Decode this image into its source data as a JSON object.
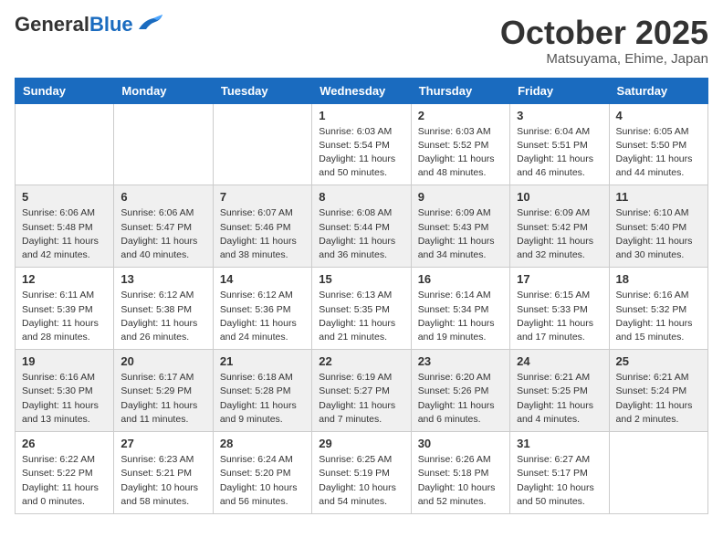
{
  "header": {
    "logo_general": "General",
    "logo_blue": "Blue",
    "month": "October 2025",
    "location": "Matsuyama, Ehime, Japan"
  },
  "weekdays": [
    "Sunday",
    "Monday",
    "Tuesday",
    "Wednesday",
    "Thursday",
    "Friday",
    "Saturday"
  ],
  "rows": [
    {
      "cells": [
        {
          "day": "",
          "info": ""
        },
        {
          "day": "",
          "info": ""
        },
        {
          "day": "",
          "info": ""
        },
        {
          "day": "1",
          "info": "Sunrise: 6:03 AM\nSunset: 5:54 PM\nDaylight: 11 hours\nand 50 minutes."
        },
        {
          "day": "2",
          "info": "Sunrise: 6:03 AM\nSunset: 5:52 PM\nDaylight: 11 hours\nand 48 minutes."
        },
        {
          "day": "3",
          "info": "Sunrise: 6:04 AM\nSunset: 5:51 PM\nDaylight: 11 hours\nand 46 minutes."
        },
        {
          "day": "4",
          "info": "Sunrise: 6:05 AM\nSunset: 5:50 PM\nDaylight: 11 hours\nand 44 minutes."
        }
      ]
    },
    {
      "cells": [
        {
          "day": "5",
          "info": "Sunrise: 6:06 AM\nSunset: 5:48 PM\nDaylight: 11 hours\nand 42 minutes."
        },
        {
          "day": "6",
          "info": "Sunrise: 6:06 AM\nSunset: 5:47 PM\nDaylight: 11 hours\nand 40 minutes."
        },
        {
          "day": "7",
          "info": "Sunrise: 6:07 AM\nSunset: 5:46 PM\nDaylight: 11 hours\nand 38 minutes."
        },
        {
          "day": "8",
          "info": "Sunrise: 6:08 AM\nSunset: 5:44 PM\nDaylight: 11 hours\nand 36 minutes."
        },
        {
          "day": "9",
          "info": "Sunrise: 6:09 AM\nSunset: 5:43 PM\nDaylight: 11 hours\nand 34 minutes."
        },
        {
          "day": "10",
          "info": "Sunrise: 6:09 AM\nSunset: 5:42 PM\nDaylight: 11 hours\nand 32 minutes."
        },
        {
          "day": "11",
          "info": "Sunrise: 6:10 AM\nSunset: 5:40 PM\nDaylight: 11 hours\nand 30 minutes."
        }
      ]
    },
    {
      "cells": [
        {
          "day": "12",
          "info": "Sunrise: 6:11 AM\nSunset: 5:39 PM\nDaylight: 11 hours\nand 28 minutes."
        },
        {
          "day": "13",
          "info": "Sunrise: 6:12 AM\nSunset: 5:38 PM\nDaylight: 11 hours\nand 26 minutes."
        },
        {
          "day": "14",
          "info": "Sunrise: 6:12 AM\nSunset: 5:36 PM\nDaylight: 11 hours\nand 24 minutes."
        },
        {
          "day": "15",
          "info": "Sunrise: 6:13 AM\nSunset: 5:35 PM\nDaylight: 11 hours\nand 21 minutes."
        },
        {
          "day": "16",
          "info": "Sunrise: 6:14 AM\nSunset: 5:34 PM\nDaylight: 11 hours\nand 19 minutes."
        },
        {
          "day": "17",
          "info": "Sunrise: 6:15 AM\nSunset: 5:33 PM\nDaylight: 11 hours\nand 17 minutes."
        },
        {
          "day": "18",
          "info": "Sunrise: 6:16 AM\nSunset: 5:32 PM\nDaylight: 11 hours\nand 15 minutes."
        }
      ]
    },
    {
      "cells": [
        {
          "day": "19",
          "info": "Sunrise: 6:16 AM\nSunset: 5:30 PM\nDaylight: 11 hours\nand 13 minutes."
        },
        {
          "day": "20",
          "info": "Sunrise: 6:17 AM\nSunset: 5:29 PM\nDaylight: 11 hours\nand 11 minutes."
        },
        {
          "day": "21",
          "info": "Sunrise: 6:18 AM\nSunset: 5:28 PM\nDaylight: 11 hours\nand 9 minutes."
        },
        {
          "day": "22",
          "info": "Sunrise: 6:19 AM\nSunset: 5:27 PM\nDaylight: 11 hours\nand 7 minutes."
        },
        {
          "day": "23",
          "info": "Sunrise: 6:20 AM\nSunset: 5:26 PM\nDaylight: 11 hours\nand 6 minutes."
        },
        {
          "day": "24",
          "info": "Sunrise: 6:21 AM\nSunset: 5:25 PM\nDaylight: 11 hours\nand 4 minutes."
        },
        {
          "day": "25",
          "info": "Sunrise: 6:21 AM\nSunset: 5:24 PM\nDaylight: 11 hours\nand 2 minutes."
        }
      ]
    },
    {
      "cells": [
        {
          "day": "26",
          "info": "Sunrise: 6:22 AM\nSunset: 5:22 PM\nDaylight: 11 hours\nand 0 minutes."
        },
        {
          "day": "27",
          "info": "Sunrise: 6:23 AM\nSunset: 5:21 PM\nDaylight: 10 hours\nand 58 minutes."
        },
        {
          "day": "28",
          "info": "Sunrise: 6:24 AM\nSunset: 5:20 PM\nDaylight: 10 hours\nand 56 minutes."
        },
        {
          "day": "29",
          "info": "Sunrise: 6:25 AM\nSunset: 5:19 PM\nDaylight: 10 hours\nand 54 minutes."
        },
        {
          "day": "30",
          "info": "Sunrise: 6:26 AM\nSunset: 5:18 PM\nDaylight: 10 hours\nand 52 minutes."
        },
        {
          "day": "31",
          "info": "Sunrise: 6:27 AM\nSunset: 5:17 PM\nDaylight: 10 hours\nand 50 minutes."
        },
        {
          "day": "",
          "info": ""
        }
      ]
    }
  ]
}
